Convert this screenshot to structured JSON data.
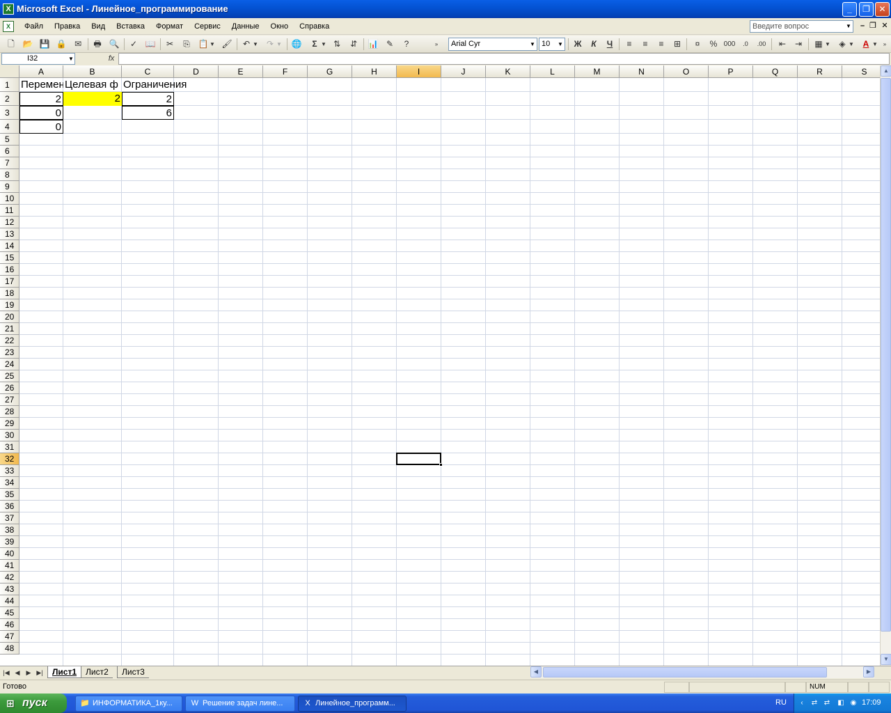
{
  "window": {
    "title": "Microsoft Excel - Линейное_программирование",
    "app_icon": "X",
    "minimize_label": "_",
    "maximize_label": "❐",
    "close_label": "✕"
  },
  "menu": {
    "items": [
      "Файл",
      "Правка",
      "Вид",
      "Вставка",
      "Формат",
      "Сервис",
      "Данные",
      "Окно",
      "Справка"
    ],
    "ask_placeholder": "Введите вопрос",
    "doc_min": "–",
    "doc_restore": "❐",
    "doc_close": "✕"
  },
  "toolbar": {
    "font_name": "Arial Cyr",
    "font_size": "10",
    "bold_label": "Ж",
    "italic_label": "К",
    "underline_label": "Ч",
    "percent_label": "%",
    "thousands_label": "000",
    "sigma_label": "Σ"
  },
  "formula_bar": {
    "name_box": "I32",
    "fx_label": "fx",
    "formula": ""
  },
  "grid": {
    "columns": [
      "A",
      "B",
      "C",
      "D",
      "E",
      "F",
      "G",
      "H",
      "I",
      "J",
      "K",
      "L",
      "M",
      "N",
      "O",
      "P",
      "Q",
      "R",
      "S"
    ],
    "selected_column": "I",
    "selected_row": "32",
    "rows": [
      "1",
      "2",
      "3",
      "4",
      "5",
      "6",
      "7",
      "8",
      "9",
      "10",
      "11",
      "12",
      "13",
      "14",
      "15",
      "16",
      "17",
      "18",
      "19",
      "20",
      "21",
      "22",
      "23",
      "24",
      "25",
      "26",
      "27",
      "28",
      "29",
      "30",
      "31",
      "32",
      "33",
      "34",
      "35",
      "36",
      "37",
      "38",
      "39",
      "40",
      "41",
      "42",
      "43",
      "44",
      "45",
      "46",
      "47",
      "48"
    ],
    "cells": {
      "A1": "Перемен",
      "B1": "Целевая ф",
      "C1": "Ограничения",
      "A2": "2",
      "B2": "2",
      "C2": "2",
      "A3": "0",
      "C3": "6",
      "A4": "0"
    },
    "highlight_color": "#ffff00",
    "selection_header_color": "#f2b94e"
  },
  "sheets": {
    "tabs": [
      "Лист1",
      "Лист2",
      "Лист3"
    ],
    "active": "Лист1"
  },
  "status": {
    "text": "Готово",
    "num_indicator": "NUM"
  },
  "taskbar": {
    "start_label": "пуск",
    "buttons": [
      {
        "label": "ИНФОРМАТИКА_1ку...",
        "icon": "folder-icon"
      },
      {
        "label": "Решение задач лине...",
        "icon": "word-icon"
      },
      {
        "label": "Линейное_программ...",
        "icon": "excel-icon"
      }
    ],
    "language": "RU",
    "clock": "17:09"
  }
}
